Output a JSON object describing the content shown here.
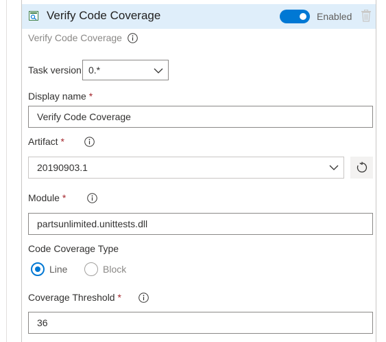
{
  "header": {
    "title": "Verify Code Coverage",
    "toggle_label": "Enabled",
    "toggle_on": true,
    "accent_color": "#0078d4",
    "header_bg": "#dfeefa"
  },
  "subtitle": "Verify Code Coverage",
  "task_version": {
    "label": "Task version",
    "value": "0.*"
  },
  "display_name": {
    "label": "Display name",
    "required_mark": "*",
    "value": "Verify Code Coverage"
  },
  "artifact": {
    "label": "Artifact",
    "required_mark": "*",
    "value": "20190903.1"
  },
  "module": {
    "label": "Module",
    "required_mark": "*",
    "value": "partsunlimited.unittests.dll"
  },
  "coverage_type": {
    "label": "Code Coverage Type",
    "options": [
      "Line",
      "Block"
    ],
    "selected": "Line"
  },
  "threshold": {
    "label": "Coverage Threshold",
    "required_mark": "*",
    "value": "36"
  },
  "icons": {
    "task": "task-icon",
    "info": "info-icon",
    "trash": "trash-icon",
    "chevron": "chevron-down-icon",
    "refresh": "refresh-icon"
  }
}
